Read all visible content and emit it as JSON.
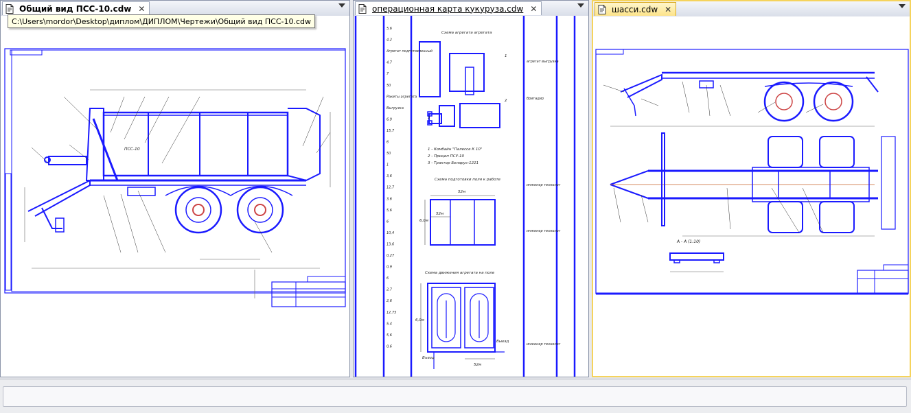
{
  "windows": [
    {
      "tab_title": "Общий вид ПСС-10.cdw",
      "tooltip": "C:\\Users\\mordor\\Desktop\\диплом\\ДИПЛОМ\\Чертежи\\Общий вид ПСС-10.cdw",
      "drawing": {
        "body_label": "ПСС-10"
      }
    },
    {
      "tab_title": "операционная карта кукуруза.cdw",
      "drawing": {
        "scheme1_title": "Схема агрегата агрегата",
        "scheme2_title": "Схема подготовки поля к работе",
        "scheme3_title": "Схема движения агрегата на поле",
        "legend": [
          "1 - Комбайн \"Палессе К 10\"",
          "2 - Прицеп ПСУ-10",
          "3 - Трактор Беларус-1221"
        ],
        "dim_main": "52м",
        "dim_side": "6,0м",
        "dim_bottom": "52м",
        "entry_label": "Въезд",
        "exit_label": "Выезд",
        "left_column": [
          "5,6",
          "4,2",
          "Агрегат подготовленный",
          "4,7",
          "7",
          "50",
          "Ракеты агрегата",
          "Выгрузка",
          "6,9",
          "15,7",
          "6",
          "50",
          "1",
          "3,6",
          "12,7",
          "3,6",
          "5,6",
          "6",
          "10,4",
          "13,6",
          "0,27",
          "0,9",
          "6",
          "2,7",
          "2,6",
          "12,75",
          "5,4",
          "5,6",
          "0,6"
        ],
        "right_column": [
          "агрегат выгрузка",
          "бригадир",
          "инженер технолог",
          "инженер технолог",
          "инженер технолог"
        ]
      }
    },
    {
      "tab_title": "шасси.cdw",
      "drawing": {
        "section_label": "А - А (1:10)"
      }
    }
  ],
  "colors": {
    "line": "#1a1aff",
    "accent_tab": "#fde48a"
  }
}
